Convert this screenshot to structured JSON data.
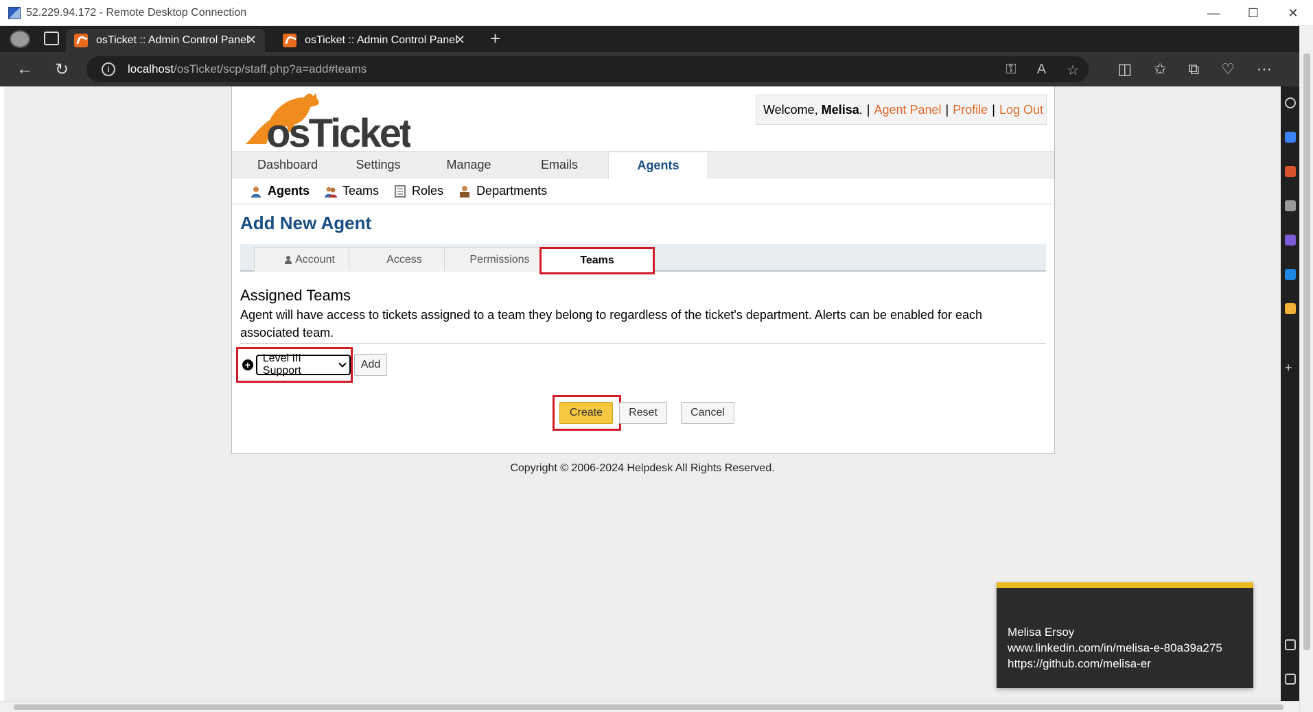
{
  "rdp": {
    "title": "52.229.94.172 - Remote Desktop Connection"
  },
  "browser": {
    "tabs": [
      {
        "title": "osTicket :: Admin Control Panel"
      },
      {
        "title": "osTicket :: Admin Control Panel"
      }
    ],
    "url_host": "localhost",
    "url_path": "/osTicket/scp/staff.php?a=add#teams"
  },
  "header": {
    "welcome_prefix": "Welcome, ",
    "user_name": "Melisa",
    "welcome_suffix": ".",
    "links": [
      "Agent Panel",
      "Profile",
      "Log Out"
    ],
    "separator": "|"
  },
  "nav": {
    "items": [
      "Dashboard",
      "Settings",
      "Manage",
      "Emails",
      "Agents"
    ],
    "active": "Agents"
  },
  "subnav": {
    "items": [
      "Agents",
      "Teams",
      "Roles",
      "Departments"
    ],
    "active": "Agents"
  },
  "page": {
    "title": "Add New Agent",
    "tabs": [
      "Account",
      "Access",
      "Permissions",
      "Teams"
    ],
    "active_tab": "Teams",
    "section_title": "Assigned Teams",
    "section_desc": "Agent will have access to tickets assigned to a team they belong to regardless of the ticket's department. Alerts can be enabled for each associated team.",
    "team_select_value": "Level III Support",
    "add_label": "Add",
    "create_label": "Create",
    "reset_label": "Reset",
    "cancel_label": "Cancel"
  },
  "footer": {
    "copyright": "Copyright © 2006-2024 Helpdesk All Rights Reserved."
  },
  "overlay": {
    "lines": [
      "Melisa Ersoy",
      "www.linkedin.com/in/melisa-e-80a39a275",
      "https://github.com/melisa-er"
    ]
  },
  "colors": {
    "brand": "#184e81",
    "link": "#e06a2c",
    "highlight": "#d11a26",
    "create": "#f5c842"
  },
  "logo_text": "osTicket"
}
